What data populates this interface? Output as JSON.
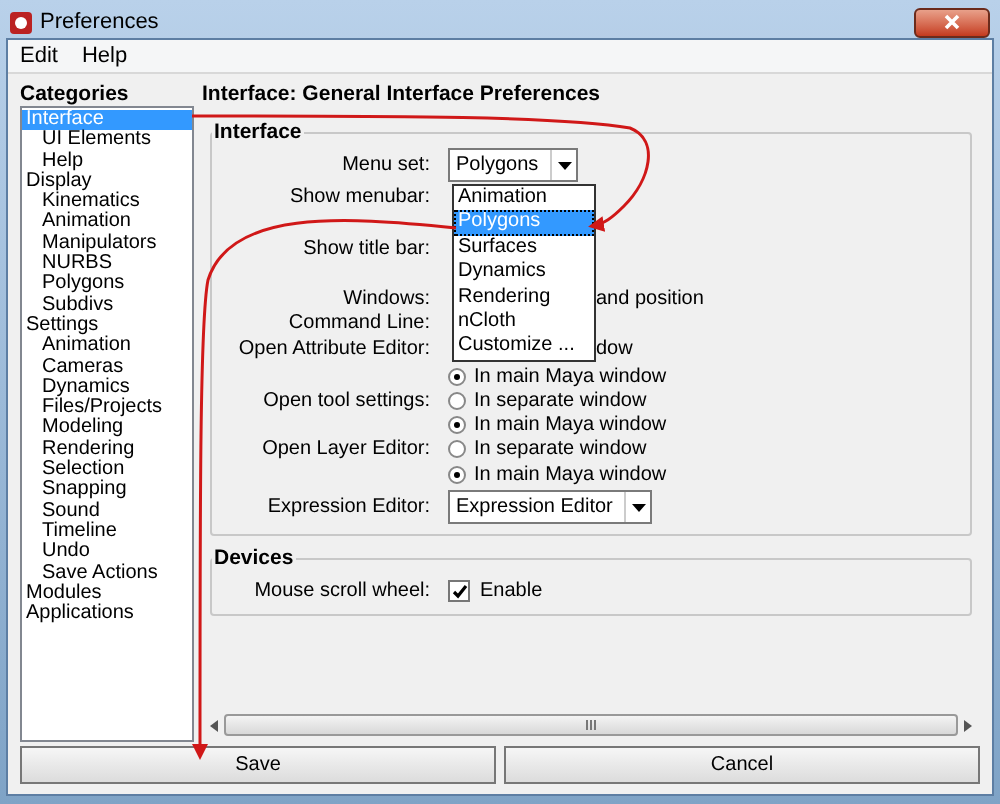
{
  "window": {
    "title": "Preferences"
  },
  "menu": [
    "Edit",
    "Help"
  ],
  "categories": {
    "title": "Categories",
    "items": [
      {
        "label": "Interface",
        "selected": true,
        "children": [
          {
            "label": "UI Elements",
            "selected": false
          },
          {
            "label": "Help",
            "selected": false
          }
        ]
      },
      {
        "label": "Display",
        "selected": false,
        "children": [
          {
            "label": "Kinematics",
            "selected": false
          },
          {
            "label": "Animation",
            "selected": false
          },
          {
            "label": "Manipulators",
            "selected": false
          },
          {
            "label": "NURBS",
            "selected": false
          },
          {
            "label": "Polygons",
            "selected": false
          },
          {
            "label": "Subdivs",
            "selected": false
          }
        ]
      },
      {
        "label": "Settings",
        "selected": false,
        "children": [
          {
            "label": "Animation",
            "selected": false
          },
          {
            "label": "Cameras",
            "selected": false
          },
          {
            "label": "Dynamics",
            "selected": false
          },
          {
            "label": "Files/Projects",
            "selected": false
          },
          {
            "label": "Modeling",
            "selected": false
          },
          {
            "label": "Rendering",
            "selected": false
          },
          {
            "label": "Selection",
            "selected": false
          },
          {
            "label": "Snapping",
            "selected": false
          },
          {
            "label": "Sound",
            "selected": false
          },
          {
            "label": "Timeline",
            "selected": false
          },
          {
            "label": "Undo",
            "selected": false
          },
          {
            "label": "Save Actions",
            "selected": false
          }
        ]
      },
      {
        "label": "Modules",
        "selected": false
      },
      {
        "label": "Applications",
        "selected": false
      }
    ]
  },
  "panel_title": "Interface: General Interface Preferences",
  "groups": [
    {
      "title": "Interface",
      "rows": [
        {
          "kind": "dropdown",
          "label": "Menu set:",
          "value": "Polygons"
        },
        {
          "kind": "covered",
          "label": "Show menubar:"
        },
        {
          "kind": "covered",
          "label": "Show title bar:"
        },
        {
          "kind": "covered",
          "label": "Windows:",
          "tail": "and position"
        },
        {
          "kind": "covered",
          "label": "Command Line:"
        },
        {
          "kind": "covered",
          "label": "Open Attribute Editor:",
          "tail": "dow"
        },
        {
          "kind": "radio",
          "option": "In main Maya window",
          "selected": true
        },
        {
          "kind": "radio",
          "label": "Open tool settings:",
          "option": "In separate window",
          "selected": false
        },
        {
          "kind": "radio",
          "option": "In main Maya window",
          "selected": true
        },
        {
          "kind": "radio",
          "label": "Open Layer Editor:",
          "option": "In separate window",
          "selected": false
        },
        {
          "kind": "radio",
          "option": "In main Maya window",
          "selected": true
        },
        {
          "kind": "dropdown",
          "label": "Expression Editor:",
          "value": "Expression Editor"
        }
      ]
    },
    {
      "title": "Devices",
      "rows": [
        {
          "kind": "checkbox",
          "label": "Mouse scroll wheel:",
          "option": "Enable",
          "checked": true
        }
      ]
    }
  ],
  "menu_set_list": [
    {
      "label": "Animation",
      "selected": false
    },
    {
      "label": "Polygons",
      "selected": true
    },
    {
      "label": "Surfaces",
      "selected": false
    },
    {
      "label": "Dynamics",
      "selected": false
    },
    {
      "label": "Rendering",
      "selected": false
    },
    {
      "label": "nCloth",
      "selected": false
    },
    {
      "label": "Customize ...",
      "selected": false
    }
  ],
  "buttons": [
    "Save",
    "Cancel"
  ]
}
